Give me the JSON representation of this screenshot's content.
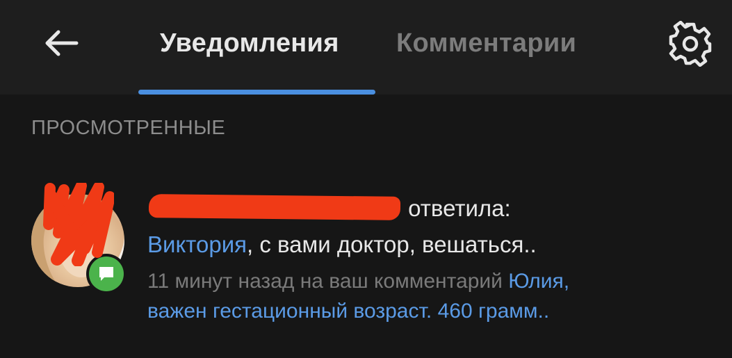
{
  "header": {
    "tabs": [
      {
        "label": "Уведомления",
        "active": true
      },
      {
        "label": "Комментарии",
        "active": false
      }
    ],
    "back_icon": "arrow-left-icon",
    "settings_icon": "gear-icon"
  },
  "section": {
    "title": "ПРОСМОТРЕННЫЕ"
  },
  "notification": {
    "author_redacted": "redacted",
    "action": " ответила:",
    "reply_to_name": "Виктория",
    "reply_text": ", с вами доктор, вешаться..",
    "meta_text": "11 минут назад на ваш комментарий ",
    "comment_snippet_start": "Юлия,",
    "comment_snippet_end": "важен гестационный возраст. 460 грамм..",
    "badge_icon": "comment-bubble-icon"
  },
  "colors": {
    "background": "#161616",
    "header_bg": "#1e1e1e",
    "accent": "#4a8fe0",
    "link": "#5b9be6",
    "badge": "#4bb34b",
    "redaction": "#f03a16"
  }
}
